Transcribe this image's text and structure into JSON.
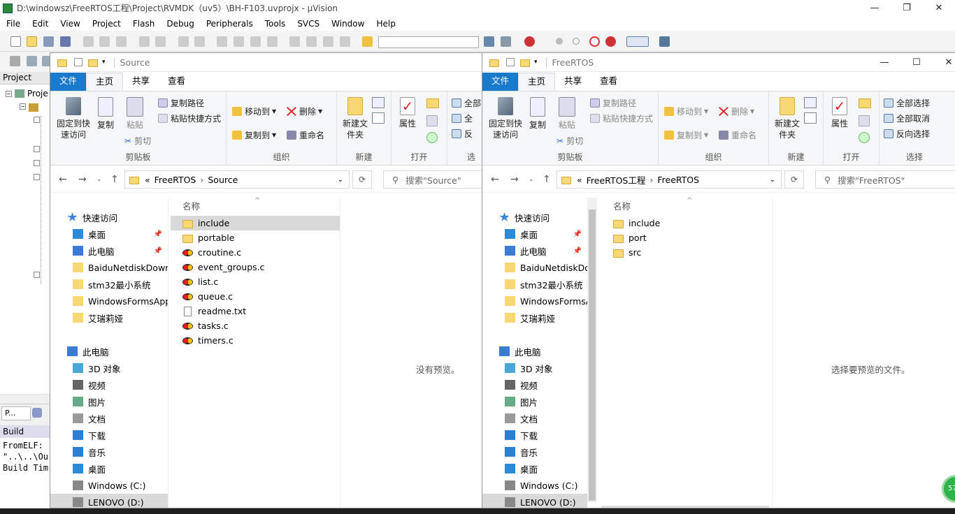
{
  "uvision": {
    "title": "D:\\windowsz\\FreeRTOS工程\\Project\\RVMDK（uv5）\\BH-F103.uvprojx - µVision",
    "menu": [
      "File",
      "Edit",
      "View",
      "Project",
      "Flash",
      "Debug",
      "Peripherals",
      "Tools",
      "SVCS",
      "Window",
      "Help"
    ],
    "project_panel_title": "Project",
    "project_root": "Proje",
    "tab_project": "P...",
    "build_output_title": "Build Output",
    "build_lines": [
      "FromELF:",
      "\"..\\..\\Ou",
      "Build Tim"
    ]
  },
  "left_window": {
    "title": "Source",
    "ribbon_tabs": [
      "文件",
      "主页",
      "共享",
      "查看"
    ],
    "active_tab": "主页",
    "ribbon": {
      "pin": "固定到快速访问",
      "copy": "复制",
      "paste": "粘贴",
      "copy_path": "复制路径",
      "paste_shortcut": "粘贴快捷方式",
      "cut": "剪切",
      "clipboard": "剪贴板",
      "move_to": "移动到",
      "copy_to": "复制到",
      "delete": "删除",
      "rename": "重命名",
      "organize": "组织",
      "new_folder": "新建文件夹",
      "new": "新建",
      "properties": "属性",
      "open": "打开",
      "select_all": "全部",
      "select_none": "全",
      "invert": "反",
      "select": "选"
    },
    "breadcrumb": [
      "FreeRTOS",
      "Source"
    ],
    "search_placeholder": "搜索\"Source\"",
    "column_name": "名称",
    "files": [
      {
        "name": "include",
        "type": "folder"
      },
      {
        "name": "portable",
        "type": "folder"
      },
      {
        "name": "croutine.c",
        "type": "c"
      },
      {
        "name": "event_groups.c",
        "type": "c"
      },
      {
        "name": "list.c",
        "type": "c"
      },
      {
        "name": "queue.c",
        "type": "c"
      },
      {
        "name": "readme.txt",
        "type": "txt"
      },
      {
        "name": "tasks.c",
        "type": "c"
      },
      {
        "name": "timers.c",
        "type": "c"
      }
    ],
    "preview_text": "没有预览。",
    "nav": [
      {
        "label": "快速访问",
        "icon": "star-icon",
        "indent": 0,
        "pin": false
      },
      {
        "label": "桌面",
        "icon": "desktop-icon",
        "indent": 1,
        "pin": true
      },
      {
        "label": "此电脑",
        "icon": "computer-icon",
        "indent": 1,
        "pin": true
      },
      {
        "label": "BaiduNetdiskDownl",
        "icon": "folder-icon",
        "indent": 1,
        "pin": false
      },
      {
        "label": "stm32最小系统",
        "icon": "folder-icon",
        "indent": 1,
        "pin": false
      },
      {
        "label": "WindowsFormsApp",
        "icon": "folder-icon",
        "indent": 1,
        "pin": false
      },
      {
        "label": "艾瑞莉娅",
        "icon": "folder-icon",
        "indent": 1,
        "pin": false
      },
      {
        "label": "",
        "icon": "",
        "indent": 0,
        "pin": false
      },
      {
        "label": "此电脑",
        "icon": "computer-icon",
        "indent": 0,
        "pin": false
      },
      {
        "label": "3D 对象",
        "icon": "cube-icon",
        "indent": 1,
        "pin": false
      },
      {
        "label": "视频",
        "icon": "video-icon",
        "indent": 1,
        "pin": false
      },
      {
        "label": "图片",
        "icon": "picture-icon",
        "indent": 1,
        "pin": false
      },
      {
        "label": "文档",
        "icon": "document-icon",
        "indent": 1,
        "pin": false
      },
      {
        "label": "下载",
        "icon": "download-icon",
        "indent": 1,
        "pin": false
      },
      {
        "label": "音乐",
        "icon": "music-icon",
        "indent": 1,
        "pin": false
      },
      {
        "label": "桌面",
        "icon": "desktop-icon",
        "indent": 1,
        "pin": false
      },
      {
        "label": "Windows (C:)",
        "icon": "drive-icon",
        "indent": 1,
        "pin": false
      },
      {
        "label": "LENOVO (D:)",
        "icon": "drive-icon",
        "indent": 1,
        "pin": false,
        "selected": true
      }
    ]
  },
  "right_window": {
    "title": "FreeRTOS",
    "ribbon_tabs": [
      "文件",
      "主页",
      "共享",
      "查看"
    ],
    "active_tab": "主页",
    "ribbon": {
      "pin": "固定到快速访问",
      "copy": "复制",
      "paste": "粘贴",
      "copy_path": "复制路径",
      "paste_shortcut": "粘贴快捷方式",
      "cut": "剪切",
      "clipboard": "剪贴板",
      "move_to": "移动到",
      "copy_to": "复制到",
      "delete": "删除",
      "rename": "重命名",
      "organize": "组织",
      "new_folder": "新建文件夹",
      "new": "新建",
      "properties": "属性",
      "open": "打开",
      "select_all": "全部选择",
      "select_none": "全部取消",
      "invert": "反向选择",
      "select": "选择"
    },
    "breadcrumb": [
      "FreeRTOS工程",
      "FreeRTOS"
    ],
    "search_placeholder": "搜索\"FreeRTOS\"",
    "column_name": "名称",
    "files": [
      {
        "name": "include",
        "type": "folder"
      },
      {
        "name": "port",
        "type": "folder"
      },
      {
        "name": "src",
        "type": "folder"
      }
    ],
    "preview_text": "选择要预览的文件。",
    "nav": [
      {
        "label": "快速访问",
        "icon": "star-icon",
        "indent": 0,
        "pin": false
      },
      {
        "label": "桌面",
        "icon": "desktop-icon",
        "indent": 1,
        "pin": true
      },
      {
        "label": "此电脑",
        "icon": "computer-icon",
        "indent": 1,
        "pin": true
      },
      {
        "label": "BaiduNetdiskDow",
        "icon": "folder-icon",
        "indent": 1,
        "pin": false
      },
      {
        "label": "stm32最小系统",
        "icon": "folder-icon",
        "indent": 1,
        "pin": false
      },
      {
        "label": "WindowsFormsA",
        "icon": "folder-icon",
        "indent": 1,
        "pin": false
      },
      {
        "label": "艾瑞莉娅",
        "icon": "folder-icon",
        "indent": 1,
        "pin": false
      },
      {
        "label": "",
        "icon": "",
        "indent": 0,
        "pin": false
      },
      {
        "label": "此电脑",
        "icon": "computer-icon",
        "indent": 0,
        "pin": false
      },
      {
        "label": "3D 对象",
        "icon": "cube-icon",
        "indent": 1,
        "pin": false
      },
      {
        "label": "视频",
        "icon": "video-icon",
        "indent": 1,
        "pin": false
      },
      {
        "label": "图片",
        "icon": "picture-icon",
        "indent": 1,
        "pin": false
      },
      {
        "label": "文档",
        "icon": "document-icon",
        "indent": 1,
        "pin": false
      },
      {
        "label": "下载",
        "icon": "download-icon",
        "indent": 1,
        "pin": false
      },
      {
        "label": "音乐",
        "icon": "music-icon",
        "indent": 1,
        "pin": false
      },
      {
        "label": "桌面",
        "icon": "desktop-icon",
        "indent": 1,
        "pin": false
      },
      {
        "label": "Windows (C:)",
        "icon": "drive-icon",
        "indent": 1,
        "pin": false
      },
      {
        "label": "LENOVO (D:)",
        "icon": "drive-icon",
        "indent": 1,
        "pin": false,
        "selected": true
      }
    ]
  },
  "badge_text": "57",
  "colors": {
    "file_tab": "#1979ca",
    "folder": "#f8d775",
    "selection": "#d9d9d9"
  }
}
